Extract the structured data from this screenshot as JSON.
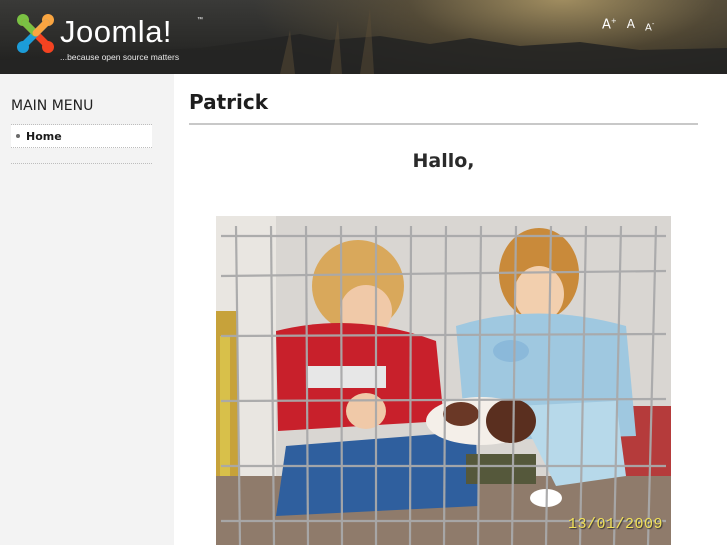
{
  "header": {
    "logo_text": "Joomla!",
    "logo_tm": "™",
    "tagline": "...because open source matters",
    "font_controls": {
      "bigger": "A",
      "bigger_sup": "+",
      "reset": "A",
      "smaller": "A",
      "smaller_sup": "-"
    }
  },
  "sidebar": {
    "menu_title": "MAIN MENU",
    "items": [
      {
        "label": "Home",
        "active": true
      }
    ]
  },
  "article": {
    "title": "Patrick",
    "greeting": "Hallo,",
    "photo_date_stamp": "13/01/2009"
  },
  "colors": {
    "header_bg": "#2a2a28",
    "sidebar_bg": "#f3f3f3",
    "text": "#1e1e1e",
    "date_stamp": "#f2e15a"
  }
}
